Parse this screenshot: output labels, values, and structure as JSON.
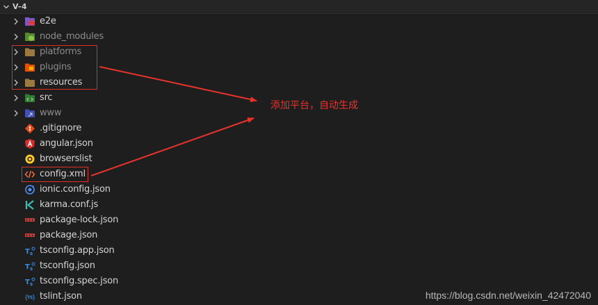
{
  "explorer": {
    "folder_title": "V-4",
    "items": [
      {
        "label": "e2e",
        "type": "folder",
        "icon": "e2e-folder-icon",
        "dim": false
      },
      {
        "label": "node_modules",
        "type": "folder",
        "icon": "node-folder-icon",
        "dim": true
      },
      {
        "label": "platforms",
        "type": "folder",
        "icon": "folder-icon",
        "dim": true
      },
      {
        "label": "plugins",
        "type": "folder",
        "icon": "plugins-folder-icon",
        "dim": true
      },
      {
        "label": "resources",
        "type": "folder",
        "icon": "folder-icon",
        "dim": false
      },
      {
        "label": "src",
        "type": "folder",
        "icon": "src-folder-icon",
        "dim": false
      },
      {
        "label": "www",
        "type": "folder",
        "icon": "www-folder-icon",
        "dim": true
      },
      {
        "label": ".gitignore",
        "type": "file",
        "icon": "git-icon",
        "dim": false
      },
      {
        "label": "angular.json",
        "type": "file",
        "icon": "angular-icon",
        "dim": false
      },
      {
        "label": "browserslist",
        "type": "file",
        "icon": "browserslist-icon",
        "dim": false
      },
      {
        "label": "config.xml",
        "type": "file",
        "icon": "xml-icon",
        "dim": false
      },
      {
        "label": "ionic.config.json",
        "type": "file",
        "icon": "ionic-icon",
        "dim": false
      },
      {
        "label": "karma.conf.js",
        "type": "file",
        "icon": "karma-icon",
        "dim": false
      },
      {
        "label": "package-lock.json",
        "type": "file",
        "icon": "npm-icon",
        "dim": false
      },
      {
        "label": "package.json",
        "type": "file",
        "icon": "npm-icon",
        "dim": false
      },
      {
        "label": "tsconfig.app.json",
        "type": "file",
        "icon": "tsconfig-icon",
        "dim": false
      },
      {
        "label": "tsconfig.json",
        "type": "file",
        "icon": "tsconfig-icon",
        "dim": false
      },
      {
        "label": "tsconfig.spec.json",
        "type": "file",
        "icon": "tsconfig-icon",
        "dim": false
      },
      {
        "label": "tslint.json",
        "type": "file",
        "icon": "tslint-icon",
        "dim": false
      }
    ]
  },
  "annotation": {
    "text": "添加平台，自动生成",
    "color": "#e8322c"
  },
  "watermark": "https://blog.csdn.net/weixin_42472040"
}
